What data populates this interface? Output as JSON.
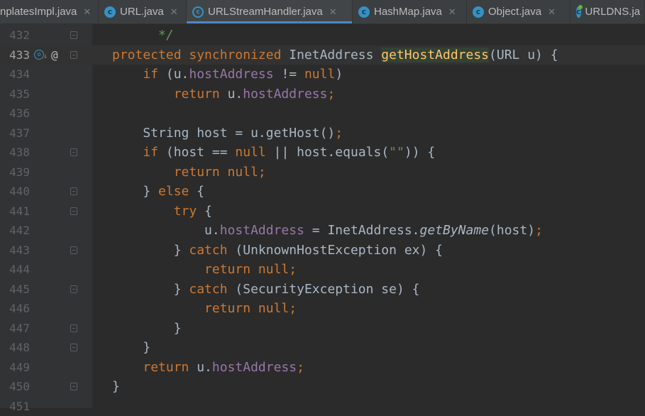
{
  "tabs": [
    {
      "label": "nplatesImpl.java",
      "icon": "none",
      "active": false
    },
    {
      "label": "URL.java",
      "icon": "java-class-icon",
      "active": false
    },
    {
      "label": "URLStreamHandler.java",
      "icon": "java-abstract-class-icon",
      "active": true
    },
    {
      "label": "HashMap.java",
      "icon": "java-class-icon",
      "active": false
    },
    {
      "label": "Object.java",
      "icon": "java-class-icon",
      "active": false
    },
    {
      "label": "URLDNS.ja",
      "icon": "java-runnable-class-icon",
      "active": false
    }
  ],
  "close_glyph": "✕",
  "gutter_marks": {
    "override_icon": "override-down-icon",
    "at_symbol": "@"
  },
  "lines": [
    {
      "num": "432",
      "tokens": [
        {
          "t": "      */",
          "c": "cm"
        }
      ]
    },
    {
      "num": "433",
      "tokens": [
        {
          "t": "protected synchronized ",
          "c": "kw"
        },
        {
          "t": "InetAddress ",
          "c": ""
        },
        {
          "t": "getHostAddress",
          "c": "fn hl"
        },
        {
          "t": "(URL u) {",
          "c": ""
        }
      ]
    },
    {
      "num": "434",
      "tokens": [
        {
          "t": "    ",
          "c": ""
        },
        {
          "t": "if ",
          "c": "kw"
        },
        {
          "t": "(u.",
          "c": ""
        },
        {
          "t": "hostAddress",
          "c": "fld"
        },
        {
          "t": " != ",
          "c": ""
        },
        {
          "t": "null",
          "c": "kw"
        },
        {
          "t": ")",
          "c": ""
        }
      ]
    },
    {
      "num": "435",
      "tokens": [
        {
          "t": "        ",
          "c": ""
        },
        {
          "t": "return ",
          "c": "kw"
        },
        {
          "t": "u.",
          "c": ""
        },
        {
          "t": "hostAddress",
          "c": "fld"
        },
        {
          "t": ";",
          "c": "kw"
        }
      ]
    },
    {
      "num": "436",
      "tokens": []
    },
    {
      "num": "437",
      "tokens": [
        {
          "t": "    String host = u.getHost()",
          "c": ""
        },
        {
          "t": ";",
          "c": "kw"
        }
      ]
    },
    {
      "num": "438",
      "tokens": [
        {
          "t": "    ",
          "c": ""
        },
        {
          "t": "if ",
          "c": "kw"
        },
        {
          "t": "(host == ",
          "c": ""
        },
        {
          "t": "null ",
          "c": "kw"
        },
        {
          "t": "|| host.equals(",
          "c": ""
        },
        {
          "t": "\"\"",
          "c": "str"
        },
        {
          "t": ")) {",
          "c": ""
        }
      ]
    },
    {
      "num": "439",
      "tokens": [
        {
          "t": "        ",
          "c": ""
        },
        {
          "t": "return null;",
          "c": "kw"
        }
      ]
    },
    {
      "num": "440",
      "tokens": [
        {
          "t": "    } ",
          "c": ""
        },
        {
          "t": "else ",
          "c": "kw"
        },
        {
          "t": "{",
          "c": ""
        }
      ]
    },
    {
      "num": "441",
      "tokens": [
        {
          "t": "        ",
          "c": ""
        },
        {
          "t": "try ",
          "c": "kw"
        },
        {
          "t": "{",
          "c": ""
        }
      ]
    },
    {
      "num": "442",
      "tokens": [
        {
          "t": "            u.",
          "c": ""
        },
        {
          "t": "hostAddress",
          "c": "fld"
        },
        {
          "t": " = InetAddress.",
          "c": ""
        },
        {
          "t": "getByName",
          "c": "it"
        },
        {
          "t": "(host)",
          "c": ""
        },
        {
          "t": ";",
          "c": "kw"
        }
      ]
    },
    {
      "num": "443",
      "tokens": [
        {
          "t": "        } ",
          "c": ""
        },
        {
          "t": "catch ",
          "c": "kw"
        },
        {
          "t": "(UnknownHostException ex) {",
          "c": ""
        }
      ]
    },
    {
      "num": "444",
      "tokens": [
        {
          "t": "            ",
          "c": ""
        },
        {
          "t": "return null;",
          "c": "kw"
        }
      ]
    },
    {
      "num": "445",
      "tokens": [
        {
          "t": "        } ",
          "c": ""
        },
        {
          "t": "catch ",
          "c": "kw"
        },
        {
          "t": "(SecurityException se) {",
          "c": ""
        }
      ]
    },
    {
      "num": "446",
      "tokens": [
        {
          "t": "            ",
          "c": ""
        },
        {
          "t": "return null;",
          "c": "kw"
        }
      ]
    },
    {
      "num": "447",
      "tokens": [
        {
          "t": "        }",
          "c": ""
        }
      ]
    },
    {
      "num": "448",
      "tokens": [
        {
          "t": "    }",
          "c": ""
        }
      ]
    },
    {
      "num": "449",
      "tokens": [
        {
          "t": "    ",
          "c": ""
        },
        {
          "t": "return ",
          "c": "kw"
        },
        {
          "t": "u.",
          "c": ""
        },
        {
          "t": "hostAddress",
          "c": "fld"
        },
        {
          "t": ";",
          "c": "kw"
        }
      ]
    },
    {
      "num": "450",
      "tokens": [
        {
          "t": "}",
          "c": ""
        }
      ]
    },
    {
      "num": "451",
      "tokens": []
    }
  ],
  "fold_lines": [
    "432",
    "433",
    "438",
    "440",
    "441",
    "443",
    "445",
    "447",
    "448",
    "450"
  ],
  "current_line": "433"
}
